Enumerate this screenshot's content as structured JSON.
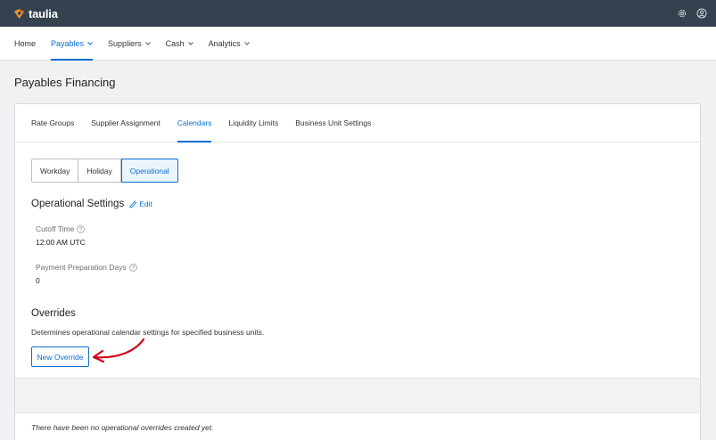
{
  "app": {
    "brand": "taulia"
  },
  "colors": {
    "topbar": "#344250",
    "accent": "#0a6ed1",
    "annotation_arrow": "#d0021b"
  },
  "topbar": {
    "icons": [
      "gear-icon",
      "user-circle-icon"
    ]
  },
  "nav": {
    "items": [
      {
        "label": "Home",
        "has_menu": false,
        "active": false
      },
      {
        "label": "Payables",
        "has_menu": true,
        "active": true
      },
      {
        "label": "Suppliers",
        "has_menu": true,
        "active": false
      },
      {
        "label": "Cash",
        "has_menu": true,
        "active": false
      },
      {
        "label": "Analytics",
        "has_menu": true,
        "active": false
      }
    ]
  },
  "page": {
    "title": "Payables Financing"
  },
  "tabs": [
    {
      "label": "Rate Groups",
      "active": false
    },
    {
      "label": "Supplier Assignment",
      "active": false
    },
    {
      "label": "Calendars",
      "active": true
    },
    {
      "label": "Liquidity Limits",
      "active": false
    },
    {
      "label": "Business Unit Settings",
      "active": false
    }
  ],
  "segments": [
    {
      "label": "Workday",
      "active": false
    },
    {
      "label": "Holiday",
      "active": false
    },
    {
      "label": "Operational",
      "active": true
    }
  ],
  "operational_settings": {
    "title": "Operational Settings",
    "edit_label": "Edit",
    "cutoff_time": {
      "label": "Cutoff Time",
      "value": "12:00 AM UTC"
    },
    "payment_preparation_days": {
      "label": "Payment Preparation Days",
      "value": "0"
    }
  },
  "overrides": {
    "title": "Overrides",
    "description": "Determines operational calendar settings for specified business units.",
    "new_button_label": "New Override",
    "empty_message": "There have been no operational overrides created yet."
  }
}
